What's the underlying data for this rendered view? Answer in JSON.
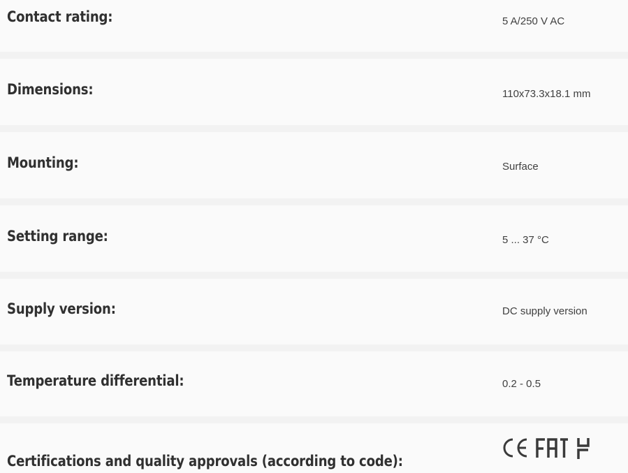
{
  "specs": [
    {
      "label": "Contact rating:",
      "value": "5 A/250 V AC"
    },
    {
      "label": "Dimensions:",
      "value": "110x73.3x18.1 mm"
    },
    {
      "label": "Mounting:",
      "value": "Surface"
    },
    {
      "label": "Setting range:",
      "value": "5 ... 37 °C"
    },
    {
      "label": "Supply version:",
      "value": "DC supply version"
    },
    {
      "label": "Temperature differential:",
      "value": "0.2 - 0.5"
    }
  ],
  "certifications": {
    "label": "Certifications and quality approvals (according to code):",
    "logos": [
      "ce-mark-icon",
      "eac-mark-icon",
      "ukca-mark-icon"
    ]
  },
  "colors": {
    "row_background": "#fafafa",
    "separator": "#f2f2f2",
    "label_text": "#303030",
    "value_text": "#404040"
  }
}
